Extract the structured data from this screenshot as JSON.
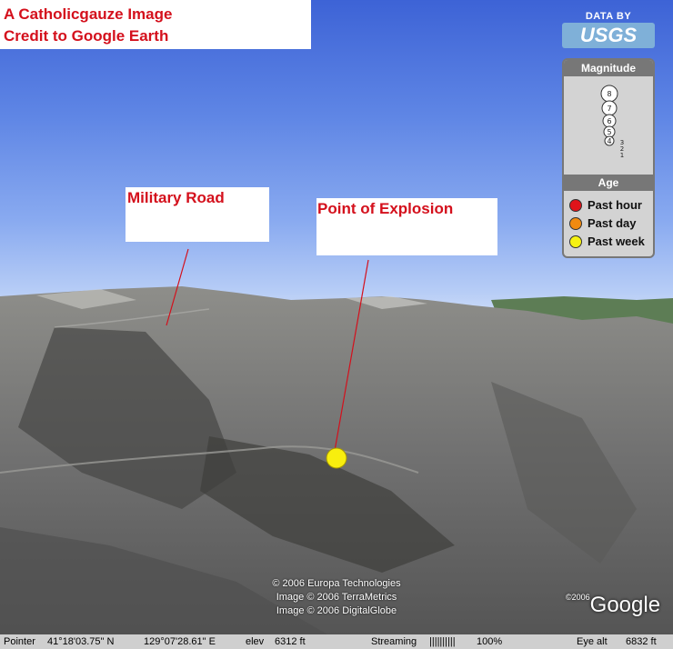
{
  "overlays": {
    "credit_line1": "A Catholicgauze Image",
    "credit_line2": "Credit to Google Earth",
    "military_road": "Military Road",
    "point_of_explosion": "Point of Explosion"
  },
  "usgs": {
    "data_by": "DATA BY",
    "logo_text": "USGS"
  },
  "legend": {
    "magnitude_title": "Magnitude",
    "magnitudes": [
      "8",
      "7",
      "6",
      "5",
      "4",
      "3",
      "2",
      "1"
    ],
    "age_title": "Age",
    "ages": [
      {
        "label": "Past hour",
        "color": "#e0141a"
      },
      {
        "label": "Past day",
        "color": "#f08a10"
      },
      {
        "label": "Past week",
        "color": "#f6f212"
      }
    ]
  },
  "attribution": {
    "line1": "© 2006 Europa Technologies",
    "line2": "Image © 2006 TerraMetrics",
    "line3": "Image © 2006 DigitalGlobe"
  },
  "google": {
    "copyright": "©2006",
    "logo": "Google"
  },
  "statusbar": {
    "pointer_label": "Pointer",
    "latitude": "41°18'03.75\"  N",
    "longitude": "129°07'28.61\"  E",
    "elev_label": "elev",
    "elev_value": "6312 ft",
    "streaming_label": "Streaming",
    "streaming_bar": "||||||||||",
    "streaming_percent": "100%",
    "eye_alt_label": "Eye alt",
    "eye_alt_value": "6832 ft"
  },
  "explosion_marker_color": "#f8ee0e"
}
